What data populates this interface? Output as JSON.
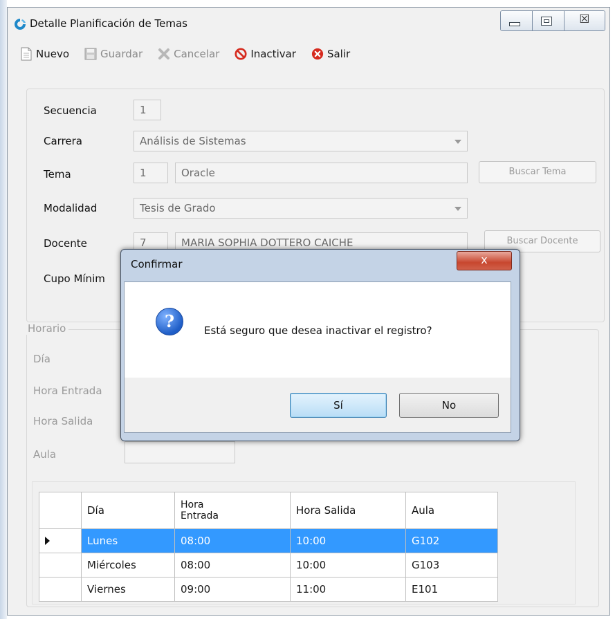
{
  "window": {
    "title": "Detalle Planificación de Temas"
  },
  "toolbar": {
    "nuevo": "Nuevo",
    "guardar": "Guardar",
    "cancelar": "Cancelar",
    "inactivar": "Inactivar",
    "salir": "Salir"
  },
  "form": {
    "secuencia": {
      "label": "Secuencia",
      "value": "1"
    },
    "carrera": {
      "label": "Carrera",
      "value": "Análisis de Sistemas"
    },
    "tema": {
      "label": "Tema",
      "id": "1",
      "value": "Oracle",
      "button": "Buscar Tema"
    },
    "modalidad": {
      "label": "Modalidad",
      "value": "Tesis de Grado"
    },
    "docente": {
      "label": "Docente",
      "id": "7",
      "value": "MARIA SOPHIA DOTTERO CAICHE",
      "button": "Buscar Docente"
    },
    "cupo_minimo": {
      "label": "Cupo Mínim"
    }
  },
  "horario": {
    "legend": "Horario",
    "dia": "Día",
    "hora_entrada": "Hora Entrada",
    "hora_salida": "Hora Salida",
    "aula": "Aula"
  },
  "grid": {
    "columns": [
      "Día",
      "Hora Entrada",
      "Hora Salida",
      "Aula"
    ],
    "rows": [
      {
        "dia": "Lunes",
        "entrada": "08:00",
        "salida": "10:00",
        "aula": "G102",
        "selected": true
      },
      {
        "dia": "Miércoles",
        "entrada": "08:00",
        "salida": "10:00",
        "aula": "G103",
        "selected": false
      },
      {
        "dia": "Viernes",
        "entrada": "09:00",
        "salida": "11:00",
        "aula": "E101",
        "selected": false
      }
    ]
  },
  "dialog": {
    "title": "Confirmar",
    "close": "x",
    "message": "Está seguro que desea inactivar el registro?",
    "yes": "Sí",
    "no": "No"
  },
  "colors": {
    "selection": "#3399ff",
    "danger": "#d62b1f"
  }
}
